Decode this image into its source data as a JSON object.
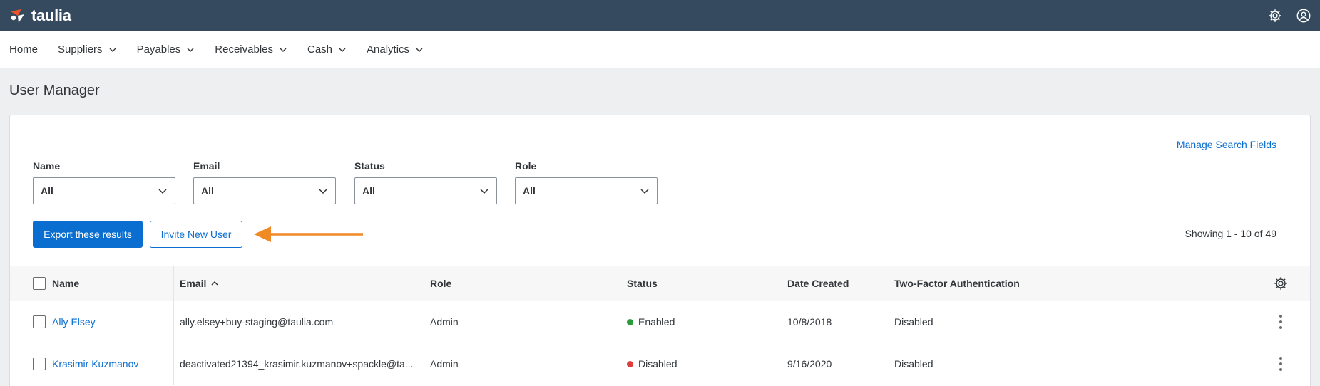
{
  "app": {
    "brand": "taulia"
  },
  "nav": {
    "items": [
      {
        "label": "Home",
        "has_dropdown": false
      },
      {
        "label": "Suppliers",
        "has_dropdown": true
      },
      {
        "label": "Payables",
        "has_dropdown": true
      },
      {
        "label": "Receivables",
        "has_dropdown": true
      },
      {
        "label": "Cash",
        "has_dropdown": true
      },
      {
        "label": "Analytics",
        "has_dropdown": true
      }
    ]
  },
  "page": {
    "title": "User Manager"
  },
  "search": {
    "manage_link": "Manage Search Fields",
    "filters": [
      {
        "label": "Name",
        "value": "All"
      },
      {
        "label": "Email",
        "value": "All"
      },
      {
        "label": "Status",
        "value": "All"
      },
      {
        "label": "Role",
        "value": "All"
      }
    ]
  },
  "actions": {
    "export_label": "Export these results",
    "invite_label": "Invite New User",
    "showing": "Showing 1 - 10 of 49"
  },
  "table": {
    "headers": {
      "name": "Name",
      "email": "Email",
      "role": "Role",
      "status": "Status",
      "date_created": "Date Created",
      "two_factor": "Two-Factor Authentication"
    },
    "sort": {
      "column": "email",
      "direction": "ascending"
    },
    "rows": [
      {
        "name": "Ally Elsey",
        "email": "ally.elsey+buy-staging@taulia.com",
        "role": "Admin",
        "status": "Enabled",
        "date_created": "10/8/2018",
        "two_factor": "Disabled"
      },
      {
        "name": "Krasimir Kuzmanov",
        "email": "deactivated21394_krasimir.kuzmanov+spackle@ta...",
        "role": "Admin",
        "status": "Disabled",
        "date_created": "9/16/2020",
        "two_factor": "Disabled"
      }
    ]
  },
  "colors": {
    "topbar": "#354a5f",
    "accent": "#0a6ed1",
    "status_enabled": "#2b9b3a",
    "status_disabled": "#e03c3c",
    "annotation_arrow": "#f08a24"
  },
  "icons": {
    "top_right": [
      "gear-icon",
      "user-account-icon"
    ],
    "logo": "taulia-logo-icon"
  }
}
